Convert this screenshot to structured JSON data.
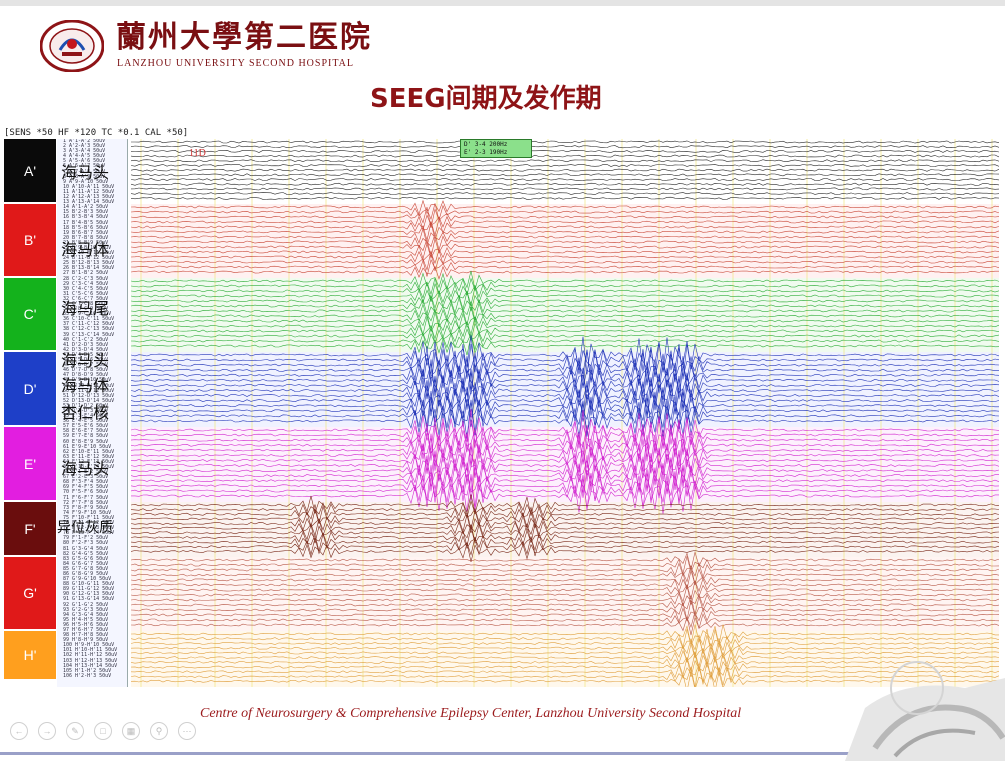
{
  "header": {
    "hospital_name_cn": "蘭州大學第二医院",
    "hospital_name_en": "LANZHOU UNIVERSITY  SECOND HOSPITAL"
  },
  "slide": {
    "title": "SEEG间期及发作期"
  },
  "eeg": {
    "settings": "[SENS *50   HF *120   TC *0.1   CAL *50]",
    "marker_label": "11D",
    "legend_lines": [
      "D' 3-4    200Hz",
      "E' 2-3    190Hz"
    ],
    "electrodes": [
      {
        "label": "A'",
        "color": "#0a0a0a",
        "trace": "#2a2a2a"
      },
      {
        "label": "B'",
        "color": "#e01919",
        "trace": "#c94a3a"
      },
      {
        "label": "C'",
        "color": "#14b21c",
        "trace": "#2fae3a"
      },
      {
        "label": "D'",
        "color": "#1e3fc8",
        "trace": "#2336b8"
      },
      {
        "label": "E'",
        "color": "#e21ee0",
        "trace": "#d229d0"
      },
      {
        "label": "F'",
        "color": "#6a0d0d",
        "trace": "#7a2a1a"
      },
      {
        "label": "G'",
        "color": "#e01919",
        "trace": "#b85a4a"
      },
      {
        "label": "H'",
        "color": "#ff9f1e",
        "trace": "#e0a040"
      }
    ],
    "anatomy": [
      "海马头",
      "海马体",
      "海马尾",
      "海马头",
      "海马体",
      "杏仁核",
      "海马头",
      "异位灰质"
    ]
  },
  "footer": {
    "text": "Centre  of  Neurosurgery & Comprehensive Epilepsy Center,  Lanzhou University Second Hospital"
  },
  "nav_icons": [
    "prev-icon",
    "next-icon",
    "pen-icon",
    "comment-icon",
    "slides-icon",
    "zoom-icon",
    "more-icon"
  ],
  "colors": {
    "brand": "#8e1417",
    "footer": "#9b1b1d"
  }
}
